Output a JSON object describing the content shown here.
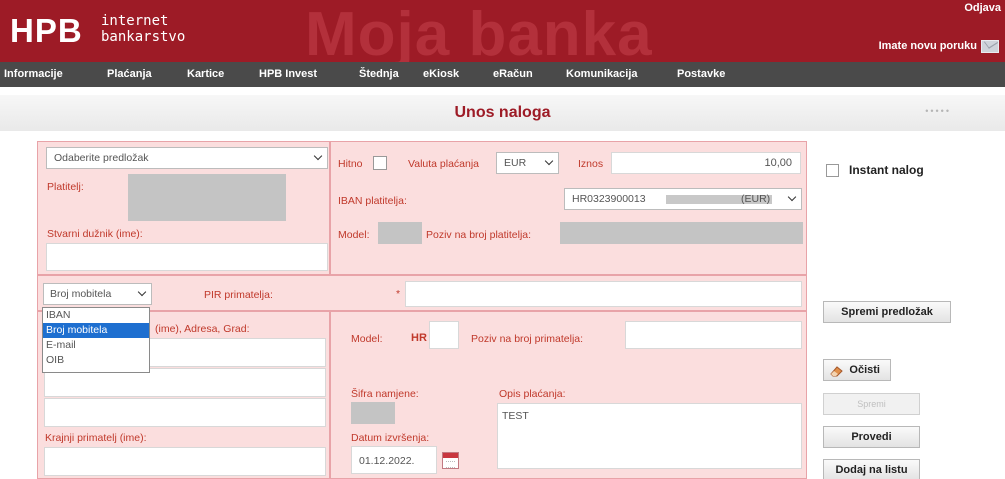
{
  "header": {
    "logo": "HPB",
    "logo_line1": "internet",
    "logo_line2": "bankarstvo",
    "watermark": "Moja banka",
    "logout": "Odjava",
    "new_message": "Imate novu poruku",
    "envelope_icon": "envelope-icon"
  },
  "nav": {
    "items": [
      "Informacije",
      "Plaćanja",
      "Kartice",
      "HPB Invest",
      "Štednja",
      "eKiosk",
      "eRačun",
      "Komunikacija",
      "Postavke"
    ]
  },
  "page": {
    "title": "Unos naloga",
    "dots": "•••••"
  },
  "payer": {
    "template_select": "Odaberite predložak",
    "platitelj_label": "Platitelj:",
    "stvarni_duznik_label": "Stvarni dužnik (ime):",
    "stvarni_duznik_value": ""
  },
  "payment": {
    "hitno_label": "Hitno",
    "valuta_label": "Valuta plaćanja",
    "valuta_value": "EUR",
    "iznos_label": "Iznos",
    "iznos_value": "10,00",
    "iban_label": "IBAN platitelja:",
    "iban_prefix": "HR0323900013",
    "iban_suffix": "(EUR)",
    "model_label": "Model:",
    "poziv_label": "Poziv na broj platitelja:"
  },
  "recipient_id": {
    "type_select": "Broj mobitela",
    "pir_label": "PIR primatelja:",
    "required_mark": "*",
    "options": [
      "IBAN",
      "Broj mobitela",
      "E-mail",
      "OIB"
    ],
    "selected_index": 1
  },
  "recipient": {
    "name_label": "(ime), Adresa, Grad:",
    "krajnji_label": "Krajnji primatelj (ime):"
  },
  "recipient_payment": {
    "model_label": "Model:",
    "model_value": "HR",
    "poziv_label": "Poziv na broj primatelja:",
    "sifra_label": "Šifra namjene:",
    "opis_label": "Opis plaćanja:",
    "opis_value": "TEST",
    "datum_label": "Datum izvršenja:",
    "datum_value": "01.12.2022."
  },
  "sidebar": {
    "instant_label": "Instant nalog",
    "spremi_predlozak": "Spremi predložak",
    "ocisti": "Očisti",
    "spremi": "Spremi",
    "provedi": "Provedi",
    "dodaj": "Dodaj na listu"
  },
  "colors": {
    "brand_red": "#9d1b26",
    "nav_bg": "#4a4a4a",
    "panel_bg": "#fbdede",
    "label_red": "#c0392b",
    "selected_option": "#1e6fd0"
  }
}
